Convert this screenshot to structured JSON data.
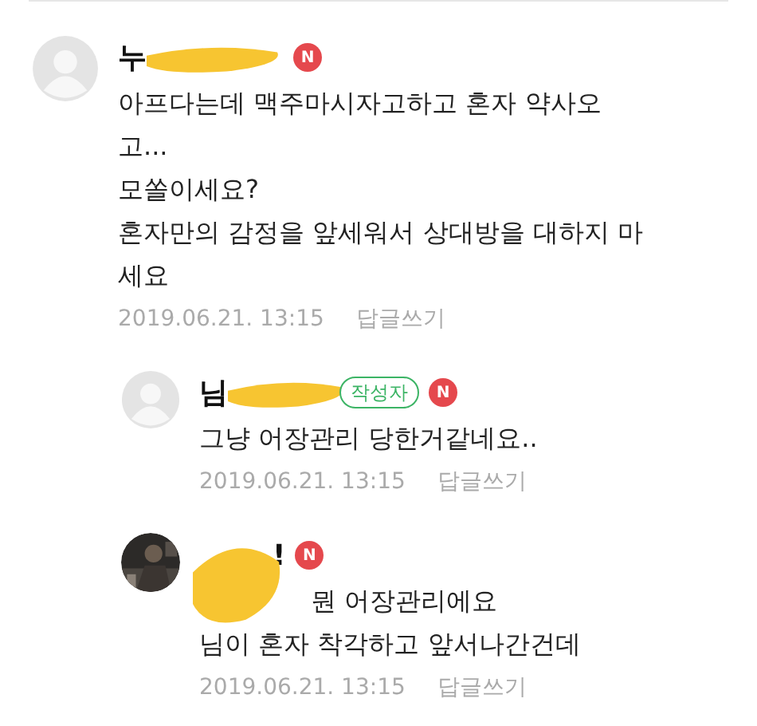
{
  "comments": [
    {
      "avatar": {
        "kind": "default"
      },
      "reply": false,
      "kind": "name_redacted",
      "author_visible": "누",
      "new_badge": "N",
      "lines": [
        "아프다는데 맥주마시자고하고 혼자 약사오",
        "고...",
        "모쏠이세요?",
        "혼자만의 감정을 앞세워서 상대방을 대하지 마",
        "세요"
      ],
      "date": "2019.06.21. 13:15",
      "reply_link": "답글쓰기"
    },
    {
      "avatar": {
        "kind": "default"
      },
      "reply": true,
      "kind": "name_redacted",
      "author_visible": "님",
      "author_tag": "작성자",
      "new_badge": "N",
      "lines": [
        "그냥 어장관리 당한거같네요.."
      ],
      "date": "2019.06.21. 13:15",
      "reply_link": "답글쓰기"
    },
    {
      "avatar": {
        "kind": "picture"
      },
      "reply": true,
      "kind": "mention_redacted",
      "author_visible": "!",
      "new_badge": "N",
      "lines": [
        "뭔 어장관리에요",
        "님이 혼자 착각하고 앞서나간건데"
      ],
      "date": "2019.06.21. 13:15",
      "reply_link": "답글쓰기"
    }
  ]
}
